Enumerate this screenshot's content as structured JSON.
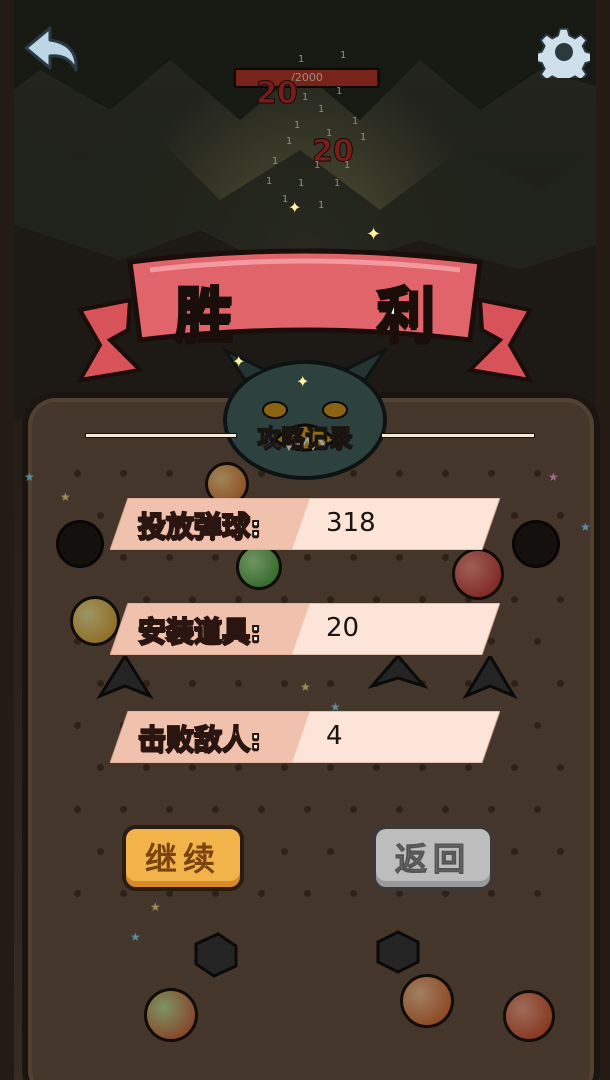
{
  "header": {
    "back_icon": "back-arrow-icon",
    "settings_icon": "gear-icon"
  },
  "enemy": {
    "hp_text": "/2000",
    "hp_fraction": 0.99,
    "damage_numbers": [
      "20",
      "20"
    ],
    "hit_marks": [
      "1",
      "1",
      "1",
      "1",
      "1",
      "1",
      "1",
      "1",
      "1",
      "1",
      "1",
      "1",
      "1",
      "1",
      "1",
      "1",
      "1",
      "1"
    ]
  },
  "result": {
    "title": "胜 利",
    "record_title": "攻略记录"
  },
  "stats": [
    {
      "label": "投放弹球:",
      "value": "318"
    },
    {
      "label": "安装道具:",
      "value": "20"
    },
    {
      "label": "击败敌人:",
      "value": "4"
    }
  ],
  "buttons": {
    "continue_label": "继续",
    "return_label": "返回"
  },
  "colors": {
    "banner": "#e0646a",
    "stat_bar": "#fde4d8",
    "continue": "#f2b34a",
    "return": "#bdbdbd"
  }
}
